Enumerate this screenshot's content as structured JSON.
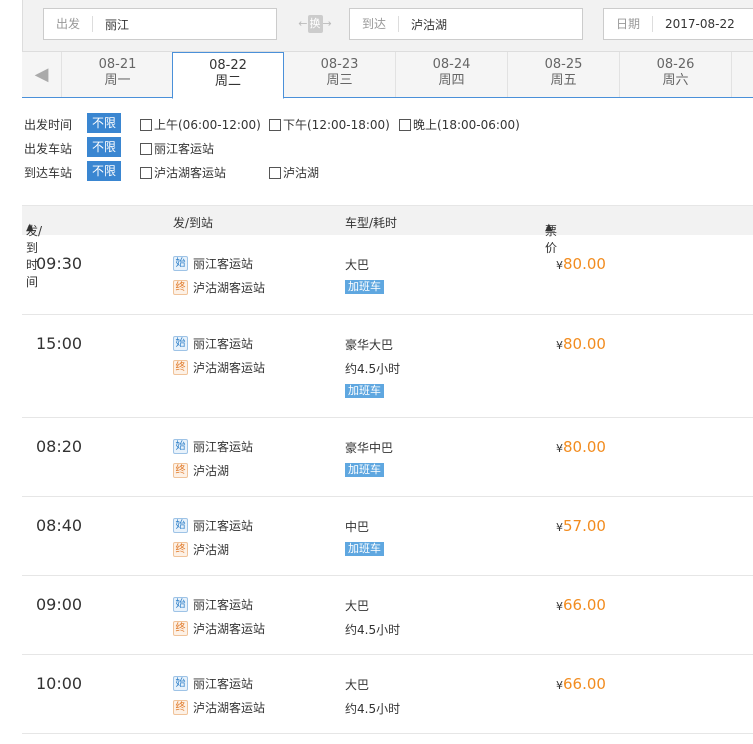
{
  "search": {
    "from_label": "出发",
    "from_value": "丽江",
    "to_label": "到达",
    "to_value": "泸沽湖",
    "date_label": "日期",
    "date_value": "2017-08-22",
    "swap_label": "换"
  },
  "date_tabs": [
    {
      "date": "08-21",
      "weekday": "周一"
    },
    {
      "date": "08-22",
      "weekday": "周二"
    },
    {
      "date": "08-23",
      "weekday": "周三"
    },
    {
      "date": "08-24",
      "weekday": "周四"
    },
    {
      "date": "08-25",
      "weekday": "周五"
    },
    {
      "date": "08-26",
      "weekday": "周六"
    }
  ],
  "filters": {
    "depart_time": {
      "label": "出发时间",
      "any": "不限",
      "options": [
        "上午(06:00-12:00)",
        "下午(12:00-18:00)",
        "晚上(18:00-06:00)"
      ]
    },
    "depart_station": {
      "label": "出发车站",
      "any": "不限",
      "options": [
        "丽江客运站"
      ]
    },
    "arrive_station": {
      "label": "到达车站",
      "any": "不限",
      "options": [
        "泸沽湖客运站",
        "泸沽湖"
      ]
    }
  },
  "table_header": {
    "time": "发/到时间",
    "station": "发/到站",
    "bus": "车型/耗时",
    "price": "票价"
  },
  "badges": {
    "start": "始",
    "end": "终"
  },
  "currency": "¥",
  "rows": [
    {
      "time": "09:30",
      "from": "丽江客运站",
      "to": "泸沽湖客运站",
      "bus_type": "大巴",
      "duration": "",
      "tag": "加班车",
      "price": "80.00"
    },
    {
      "time": "15:00",
      "from": "丽江客运站",
      "to": "泸沽湖客运站",
      "bus_type": "豪华大巴",
      "duration": "约4.5小时",
      "tag": "加班车",
      "price": "80.00"
    },
    {
      "time": "08:20",
      "from": "丽江客运站",
      "to": "泸沽湖",
      "bus_type": "豪华中巴",
      "duration": "",
      "tag": "加班车",
      "price": "80.00"
    },
    {
      "time": "08:40",
      "from": "丽江客运站",
      "to": "泸沽湖",
      "bus_type": "中巴",
      "duration": "",
      "tag": "加班车",
      "price": "57.00"
    },
    {
      "time": "09:00",
      "from": "丽江客运站",
      "to": "泸沽湖客运站",
      "bus_type": "大巴",
      "duration": "约4.5小时",
      "tag": "",
      "price": "66.00"
    },
    {
      "time": "10:00",
      "from": "丽江客运站",
      "to": "泸沽湖客运站",
      "bus_type": "大巴",
      "duration": "约4.5小时",
      "tag": "",
      "price": "66.00"
    }
  ],
  "colors": {
    "accent": "#3a86d1",
    "price": "#f28c1f",
    "tag": "#5fa7e0"
  }
}
